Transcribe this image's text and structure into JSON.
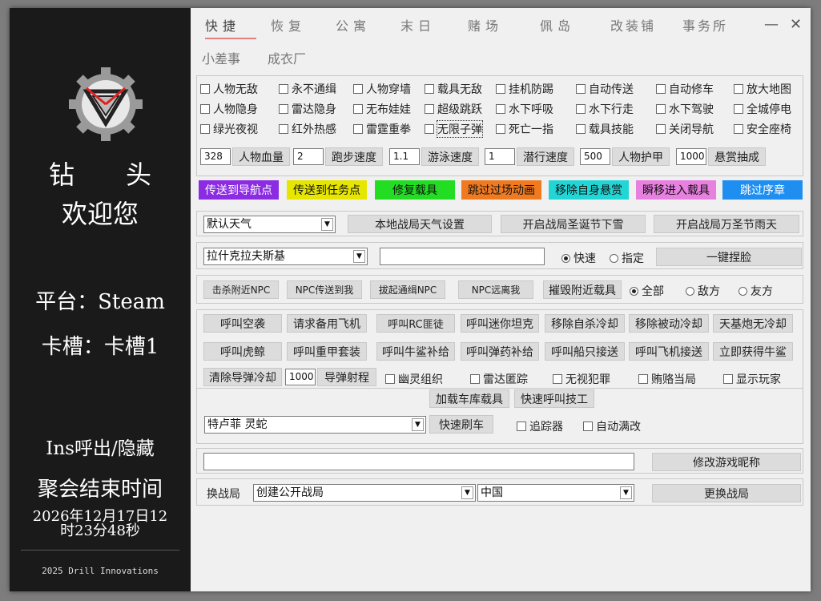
{
  "sidebar": {
    "name": "钻　　头",
    "welcome": "欢迎您",
    "platform": "平台：Steam",
    "slot": "卡槽：卡槽1",
    "toggle_hint": "Ins呼出/隐藏",
    "session_end_label": "聚会结束时间",
    "session_end_time": "2026年12月17日12时23分48秒",
    "footer": "2025 Drill Innovations",
    "logo_icon": "drill-logo-icon"
  },
  "tabs": [
    "快捷",
    "恢复",
    "公寓",
    "末日",
    "赌场",
    "佩岛",
    "改装铺",
    "事务所"
  ],
  "tabs_row2": [
    "小差事",
    "成衣厂"
  ],
  "window": {
    "minimize": "—",
    "close": "✕"
  },
  "checkboxes": {
    "row1": [
      "人物无敌",
      "永不通缉",
      "人物穿墙",
      "载具无敌",
      "挂机防踢",
      "自动传送",
      "自动修车",
      "放大地图"
    ],
    "row2": [
      "人物隐身",
      "雷达隐身",
      "无布娃娃",
      "超级跳跃",
      "水下呼吸",
      "水下行走",
      "水下驾驶",
      "全城停电"
    ],
    "row3": [
      "绿光夜视",
      "红外热感",
      "雷霆重拳",
      "无限子弹",
      "死亡一指",
      "载具技能",
      "关闭导航",
      "安全座椅"
    ]
  },
  "stats": [
    {
      "value": "328",
      "label": "人物血量"
    },
    {
      "value": "2",
      "label": "跑步速度"
    },
    {
      "value": "1.1",
      "label": "游泳速度"
    },
    {
      "value": "1",
      "label": "潜行速度"
    },
    {
      "value": "500",
      "label": "人物护甲"
    },
    {
      "value": "1000",
      "label": "悬赏抽成"
    }
  ],
  "color_buttons": [
    {
      "label": "传送到导航点",
      "bg": "#8b2be2",
      "fg": "#ffffff"
    },
    {
      "label": "传送到任务点",
      "bg": "#e6e600",
      "fg": "#111111"
    },
    {
      "label": "修复载具",
      "bg": "#22dd22",
      "fg": "#111111"
    },
    {
      "label": "跳过过场动画",
      "bg": "#f07a20",
      "fg": "#111111"
    },
    {
      "label": "移除自身悬赏",
      "bg": "#22d6d6",
      "fg": "#111111"
    },
    {
      "label": "瞬移进入载具",
      "bg": "#e880e0",
      "fg": "#111111"
    },
    {
      "label": "跳过序章",
      "bg": "#1e8ef0",
      "fg": "#ffffff"
    }
  ],
  "weather": {
    "select": "默认天气",
    "buttons": [
      "本地战局天气设置",
      "开启战局圣诞节下雪",
      "开启战局万圣节雨天"
    ]
  },
  "location": {
    "select": "拉什克拉夫斯基",
    "input": "",
    "radio_fast": "快速",
    "radio_specific": "指定",
    "button": "一键捏脸"
  },
  "npc": {
    "buttons": [
      "击杀附近NPC",
      "NPC传送到我",
      "拔起通缉NPC",
      "NPC远离我",
      "摧毁附近载具"
    ],
    "radios": [
      "全部",
      "敌方",
      "友方"
    ]
  },
  "calls": {
    "row1": [
      "呼叫空袭",
      "请求备用飞机",
      "呼叫RC匪徒",
      "呼叫迷你坦克",
      "移除自杀冷却",
      "移除被动冷却",
      "天基炮无冷却"
    ],
    "row2": [
      "呼叫虎鲸",
      "呼叫重甲套装",
      "呼叫牛鲨补给",
      "呼叫弹药补给",
      "呼叫船只接送",
      "呼叫飞机接送",
      "立即获得牛鲨"
    ],
    "row3_button": "清除导弹冷却",
    "missile_value": "1000",
    "missile_label": "导弹射程",
    "row3_checks": [
      "幽灵组织",
      "雷达匿踪",
      "无视犯罪",
      "贿赂当局",
      "显示玩家"
    ]
  },
  "vehicle": {
    "buttons": [
      "加载车库载具",
      "快速呼叫技工"
    ],
    "select": "特卢菲 灵蛇",
    "spawn": "快速刷车",
    "checks": [
      "追踪器",
      "自动满改"
    ]
  },
  "nickname": {
    "input": "",
    "button": "修改游戏昵称"
  },
  "session": {
    "label": "换战局",
    "select1": "创建公开战局",
    "select2": "中国",
    "button": "更换战局"
  }
}
